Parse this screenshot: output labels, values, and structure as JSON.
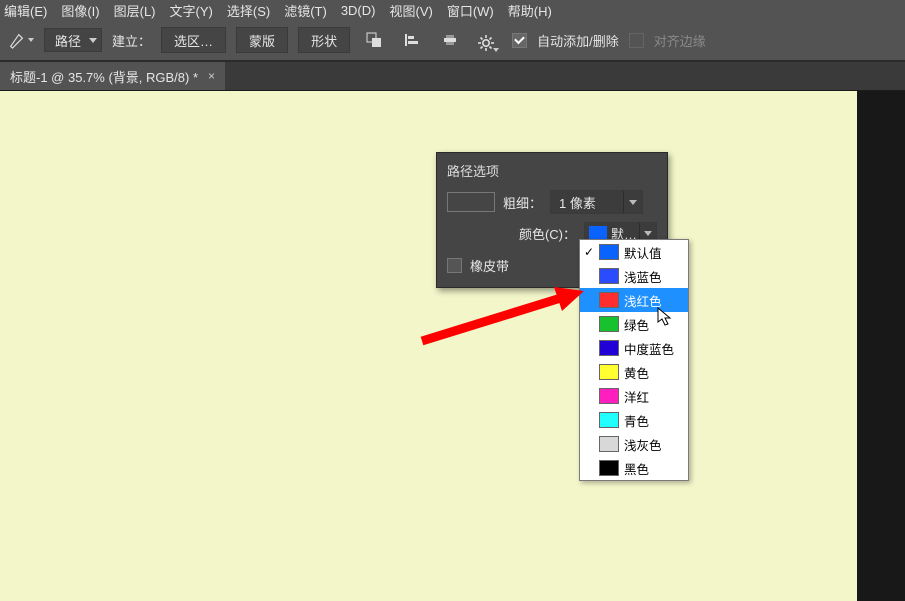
{
  "menu": {
    "edit": "编辑(E)",
    "image": "图像(I)",
    "layer": "图层(L)",
    "text": "文字(Y)",
    "select": "选择(S)",
    "filter": "滤镜(T)",
    "three_d": "3D(D)",
    "view": "视图(V)",
    "window": "窗口(W)",
    "help": "帮助(H)"
  },
  "toolbar": {
    "path_mode": "路径",
    "build": "建立：",
    "btn_selection": "选区…",
    "btn_mask": "蒙版",
    "btn_shape": "形状",
    "chk_auto": "自动添加/删除",
    "chk_align": "对齐边缘"
  },
  "tab": {
    "title": "标题-1 @ 35.7% (背景, RGB/8) *"
  },
  "popover": {
    "title": "路径选项",
    "thickness_label": "粗细：",
    "thickness_value": "1 像素",
    "color_label": "颜色(C)：",
    "color_value": "默…",
    "rubber": "橡皮带"
  },
  "colors": {
    "items": [
      {
        "name": "默认值",
        "swatch": "#0a63ff",
        "checked": true,
        "sel": false
      },
      {
        "name": "浅蓝色",
        "swatch": "#2b4bff",
        "checked": false,
        "sel": false
      },
      {
        "name": "浅红色",
        "swatch": "#ff2e2e",
        "checked": false,
        "sel": true
      },
      {
        "name": "绿色",
        "swatch": "#18c22e",
        "checked": false,
        "sel": false
      },
      {
        "name": "中度蓝色",
        "swatch": "#2100d8",
        "checked": false,
        "sel": false
      },
      {
        "name": "黄色",
        "swatch": "#ffff32",
        "checked": false,
        "sel": false
      },
      {
        "name": "洋红",
        "swatch": "#ff1fbf",
        "checked": false,
        "sel": false
      },
      {
        "name": "青色",
        "swatch": "#22ffff",
        "checked": false,
        "sel": false
      },
      {
        "name": "浅灰色",
        "swatch": "#d8d8d8",
        "checked": false,
        "sel": false
      },
      {
        "name": "黑色",
        "swatch": "#000000",
        "checked": false,
        "sel": false
      }
    ]
  }
}
